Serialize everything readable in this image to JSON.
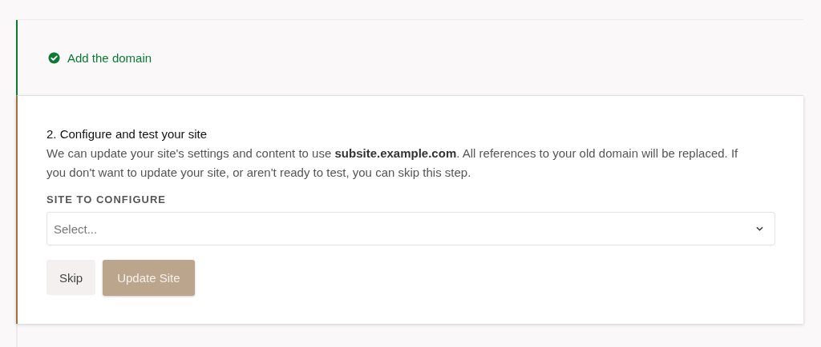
{
  "steps": [
    {
      "kind": "done",
      "title": "Add the domain",
      "completed": true
    },
    {
      "kind": "form",
      "title": "2. Configure and test your site",
      "completed": false,
      "description": "We can update your site's settings and content to use **subsite.example.com**. All references to your old domain will be replaced. If you don't want to update your site, or aren't ready to test, you can skip this step.",
      "field": {
        "label": "SITE TO CONFIGURE",
        "placeholder": "Select..."
      },
      "buttons": [
        {
          "label": "Skip",
          "kind": "secondary",
          "disabled": false
        },
        {
          "label": "Update Site",
          "kind": "primary",
          "disabled": true
        }
      ]
    }
  ]
}
